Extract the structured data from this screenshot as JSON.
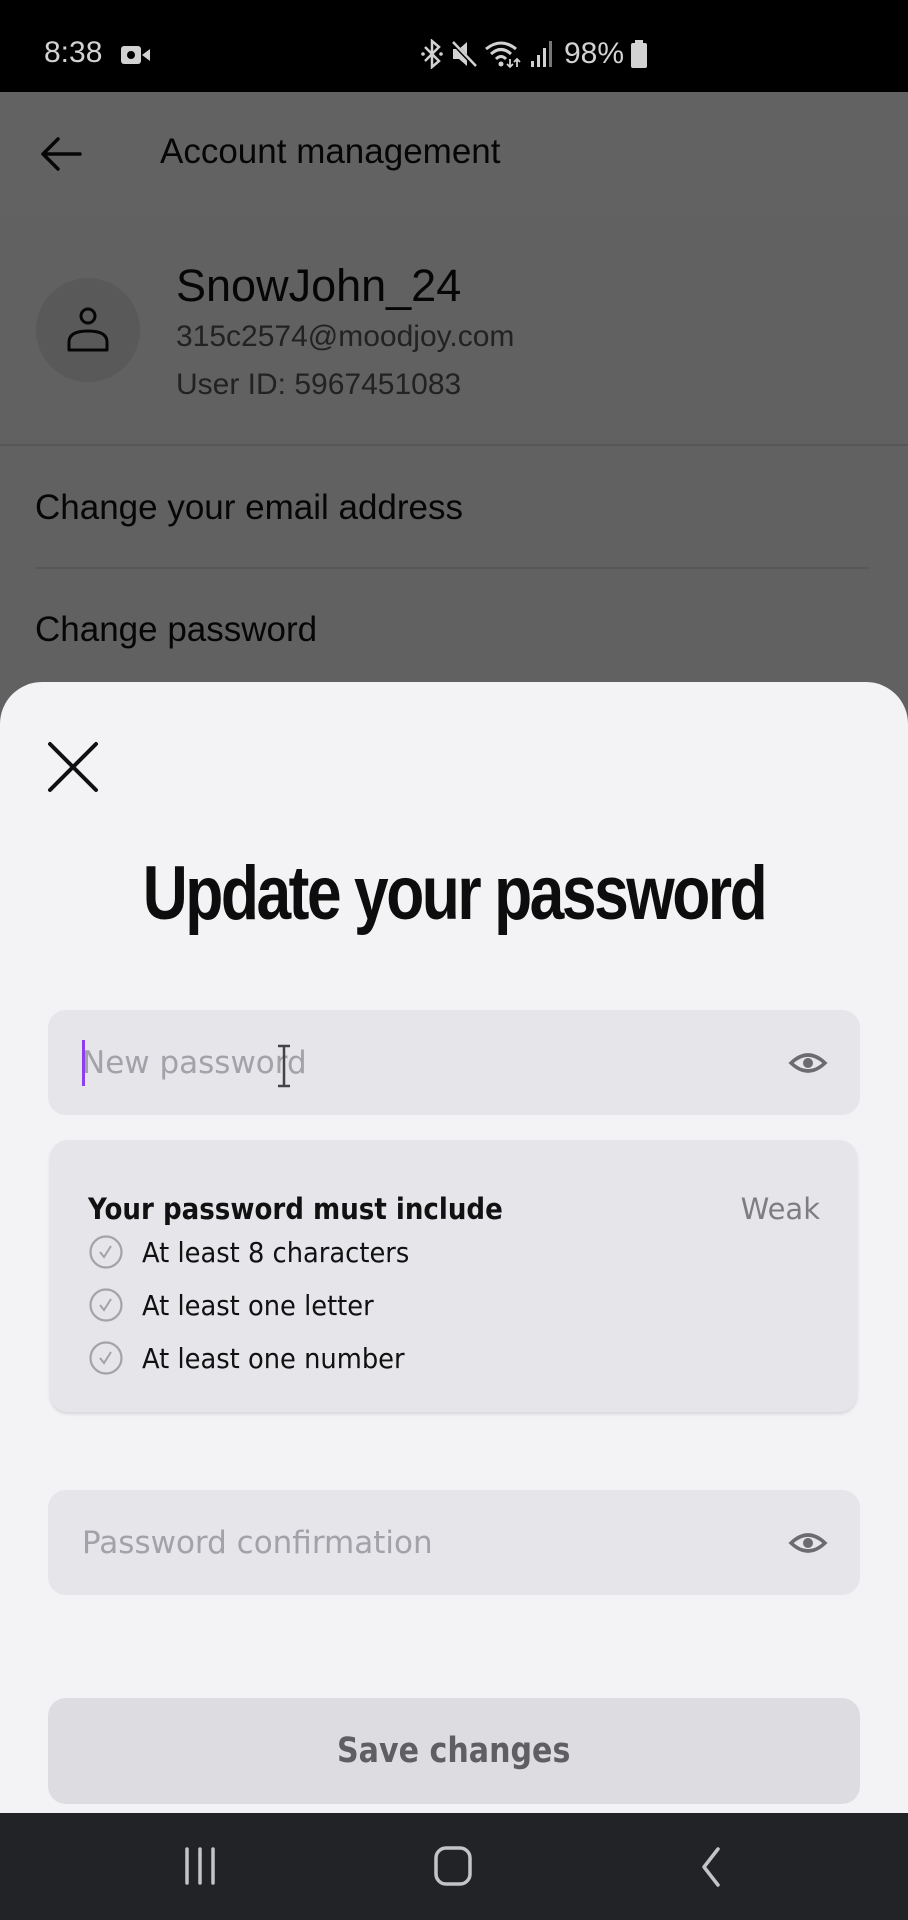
{
  "status_bar": {
    "time": "8:38",
    "battery_percent": "98%",
    "icons": [
      "screen-record-icon",
      "bluetooth-icon",
      "mute-icon",
      "wifi-icon",
      "signal-icon",
      "battery-icon"
    ]
  },
  "background_page": {
    "title": "Account management",
    "back_icon": "arrow-left-icon",
    "profile": {
      "username": "SnowJohn_24",
      "email": "315c2574@moodjoy.com",
      "user_id": "User ID: 5967451083",
      "avatar_icon": "person-icon"
    },
    "menu": [
      {
        "label": "Change your email address"
      },
      {
        "label": "Change password"
      }
    ]
  },
  "sheet": {
    "close_icon": "close-icon",
    "title": "Update your password",
    "new_password": {
      "value": "",
      "placeholder": "New password",
      "toggle_icon": "eye-icon"
    },
    "requirements": {
      "title": "Your password must include",
      "strength": "Weak",
      "items": [
        {
          "label": "At least 8 characters",
          "met": false
        },
        {
          "label": "At least one letter",
          "met": false
        },
        {
          "label": "At least one number",
          "met": false
        }
      ]
    },
    "confirm_password": {
      "value": "",
      "placeholder": "Password confirmation",
      "toggle_icon": "eye-icon"
    },
    "save_label": "Save changes"
  },
  "nav_bar": {
    "buttons": [
      "recents",
      "home",
      "back"
    ]
  },
  "colors": {
    "caret": "#8b3ff0",
    "sheet_bg": "#f3f2f5",
    "field_bg": "#e6e5ea",
    "save_disabled_bg": "#dddce0",
    "navbar_bg": "#212327"
  }
}
